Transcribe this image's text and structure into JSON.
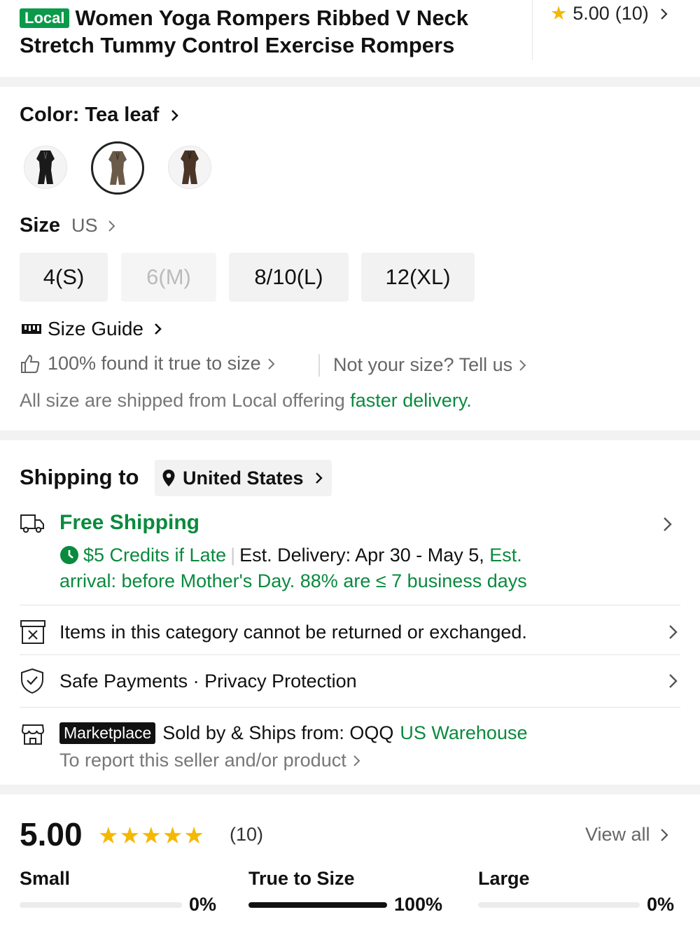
{
  "header": {
    "badge": "Local",
    "title": "Women Yoga Rompers Ribbed V Neck Stretch Tummy Control Exercise Rompers",
    "rating": "5.00",
    "rating_count": "(10)"
  },
  "color": {
    "label": "Color: Tea leaf",
    "swatches": [
      {
        "name": "Black",
        "color": "#1a1a1a",
        "selected": false
      },
      {
        "name": "Tea leaf",
        "color": "#6b5a48",
        "selected": true
      },
      {
        "name": "Brown",
        "color": "#4a3526",
        "selected": false
      }
    ]
  },
  "size": {
    "label": "Size",
    "unit": "US",
    "options": [
      {
        "label": "4(S)",
        "available": true
      },
      {
        "label": "6(M)",
        "available": false
      },
      {
        "label": "8/10(L)",
        "available": true
      },
      {
        "label": "12(XL)",
        "available": true
      }
    ],
    "guide": "Size Guide",
    "fit_text": "100% found it true to size",
    "not_your_size": "Not your size? Tell us",
    "shipped_note": "All size are shipped from Local offering ",
    "shipped_note_link": "faster delivery."
  },
  "shipping": {
    "label": "Shipping to",
    "country": "United States",
    "free_shipping": "Free Shipping",
    "credits": "$5 Credits if Late",
    "est_delivery": "Est. Delivery: Apr 30 - May 5,",
    "est_arrival_1": "Est.",
    "est_arrival_2": "arrival: before Mother's Day. 88% are ≤ 7 business days",
    "returns": "Items in this category cannot be returned or exchanged.",
    "payments": "Safe Payments · Privacy Protection",
    "marketplace_badge": "Marketplace",
    "sold_by": "Sold by & Ships from: OQQ",
    "warehouse": "US Warehouse",
    "report": "To report this seller and/or product"
  },
  "reviews": {
    "score": "5.00",
    "count": "(10)",
    "view_all": "View all",
    "fit": [
      {
        "label": "Small",
        "percent_text": "0%",
        "value": 0
      },
      {
        "label": "True to Size",
        "percent_text": "100%",
        "value": 1
      },
      {
        "label": "Large",
        "percent_text": "0%",
        "value": 0
      }
    ]
  },
  "colors": {
    "accent_green": "#0a8a3e",
    "star": "#f5b800"
  }
}
